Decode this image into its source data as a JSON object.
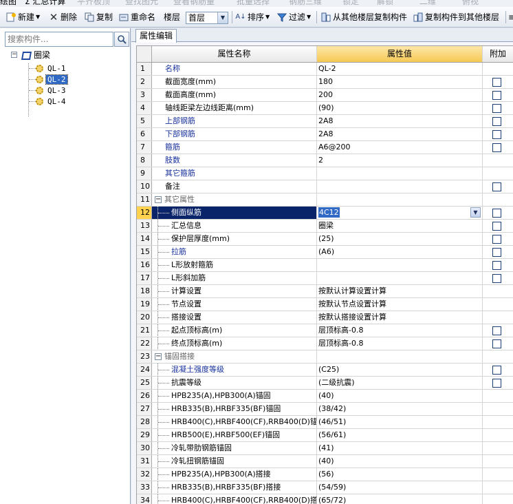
{
  "topbar": {
    "left_fragment": "绘图",
    "calc": "Σ 汇总计算",
    "disabled_items": [
      "平齐板顶",
      "查找图元",
      "查看钢筋量",
      "批量选择",
      "钢筋三维",
      "锁定",
      "解锁",
      "二维",
      "俯视"
    ]
  },
  "toolbar": {
    "new": "新建",
    "delete": "删除",
    "copy": "复制",
    "rename": "重命名",
    "floor_label": "楼层",
    "floor_value": "首层",
    "sort": "排序",
    "filter": "过滤",
    "copy_from": "从其他楼层复制构件",
    "copy_to": "复制构件到其他楼层",
    "overflow": "≡"
  },
  "left_panel": {
    "search_placeholder": "搜索构件...",
    "tree_root": "圈梁",
    "tree_items": [
      "QL-1",
      "QL-2",
      "QL-3",
      "QL-4"
    ],
    "selected_item": "QL-2"
  },
  "right_panel": {
    "tab_label": "属性编辑",
    "headers": {
      "name": "属性名称",
      "value": "属性值",
      "add": "附加"
    },
    "rows": [
      {
        "no": "1",
        "name": "名称",
        "value": "QL-2",
        "style": "blue",
        "checkbox": false
      },
      {
        "no": "2",
        "name": "截面宽度(mm)",
        "value": "180",
        "style": "",
        "checkbox": true
      },
      {
        "no": "3",
        "name": "截面高度(mm)",
        "value": "200",
        "style": "",
        "checkbox": true
      },
      {
        "no": "4",
        "name": "轴线距梁左边线距离(mm)",
        "value": "(90)",
        "style": "",
        "checkbox": true
      },
      {
        "no": "5",
        "name": "上部钢筋",
        "value": "2A8",
        "style": "blue",
        "checkbox": true
      },
      {
        "no": "6",
        "name": "下部钢筋",
        "value": "2A8",
        "style": "blue",
        "checkbox": true
      },
      {
        "no": "7",
        "name": "箍筋",
        "value": "A6@200",
        "style": "blue",
        "checkbox": true
      },
      {
        "no": "8",
        "name": "肢数",
        "value": "2",
        "style": "blue",
        "checkbox": false
      },
      {
        "no": "9",
        "name": "其它箍筋",
        "value": "",
        "style": "blue",
        "checkbox": false
      },
      {
        "no": "10",
        "name": "备注",
        "value": "",
        "style": "",
        "checkbox": true
      },
      {
        "no": "11",
        "name": "其它属性",
        "value": "",
        "style": "group",
        "checkbox": false
      },
      {
        "no": "12",
        "name": "侧面纵筋",
        "value": "4C12",
        "style": "selected",
        "checkbox": true
      },
      {
        "no": "13",
        "name": "汇总信息",
        "value": "圈梁",
        "style": "child",
        "checkbox": true
      },
      {
        "no": "14",
        "name": "保护层厚度(mm)",
        "value": "(25)",
        "style": "child",
        "checkbox": true
      },
      {
        "no": "15",
        "name": "拉筋",
        "value": "(A6)",
        "style": "child-blue",
        "checkbox": true
      },
      {
        "no": "16",
        "name": "L形放射箍筋",
        "value": "",
        "style": "child",
        "checkbox": true
      },
      {
        "no": "17",
        "name": "L形斜加筋",
        "value": "",
        "style": "child",
        "checkbox": true
      },
      {
        "no": "18",
        "name": "计算设置",
        "value": "按默认计算设置计算",
        "style": "child",
        "checkbox": false
      },
      {
        "no": "19",
        "name": "节点设置",
        "value": "按默认节点设置计算",
        "style": "child",
        "checkbox": false
      },
      {
        "no": "20",
        "name": "搭接设置",
        "value": "按默认搭接设置计算",
        "style": "child",
        "checkbox": false
      },
      {
        "no": "21",
        "name": "起点顶标高(m)",
        "value": "层顶标高-0.8",
        "style": "child",
        "checkbox": true
      },
      {
        "no": "22",
        "name": "终点顶标高(m)",
        "value": "层顶标高-0.8",
        "style": "child",
        "checkbox": true
      },
      {
        "no": "23",
        "name": "锚固搭接",
        "value": "",
        "style": "group",
        "checkbox": false
      },
      {
        "no": "24",
        "name": "混凝土强度等级",
        "value": "(C25)",
        "style": "child-blue",
        "checkbox": true
      },
      {
        "no": "25",
        "name": "抗震等级",
        "value": "(二级抗震)",
        "style": "child",
        "checkbox": true
      },
      {
        "no": "26",
        "name": "HPB235(A),HPB300(A)锚固",
        "value": "(40)",
        "style": "child",
        "checkbox": false
      },
      {
        "no": "27",
        "name": "HRB335(B),HRBF335(BF)锚固",
        "value": "(38/42)",
        "style": "child",
        "checkbox": false
      },
      {
        "no": "28",
        "name": "HRB400(C),HRBF400(CF),RRB400(D)锚",
        "value": "(46/51)",
        "style": "child",
        "checkbox": false
      },
      {
        "no": "29",
        "name": "HRB500(E),HRBF500(EF)锚固",
        "value": "(56/61)",
        "style": "child",
        "checkbox": false
      },
      {
        "no": "30",
        "name": "冷轧带肋钢筋锚固",
        "value": "(41)",
        "style": "child",
        "checkbox": false
      },
      {
        "no": "31",
        "name": "冷轧扭钢筋锚固",
        "value": "(40)",
        "style": "child",
        "checkbox": false
      },
      {
        "no": "32",
        "name": "HPB235(A),HPB300(A)搭接",
        "value": "(56)",
        "style": "child",
        "checkbox": false
      },
      {
        "no": "33",
        "name": "HRB335(B),HRBF335(BF)搭接",
        "value": "(54/59)",
        "style": "child",
        "checkbox": false
      },
      {
        "no": "34",
        "name": "HRB400(C),HRBF400(CF),RRB400(D)搭",
        "value": "(65/72)",
        "style": "child",
        "checkbox": false
      }
    ]
  }
}
